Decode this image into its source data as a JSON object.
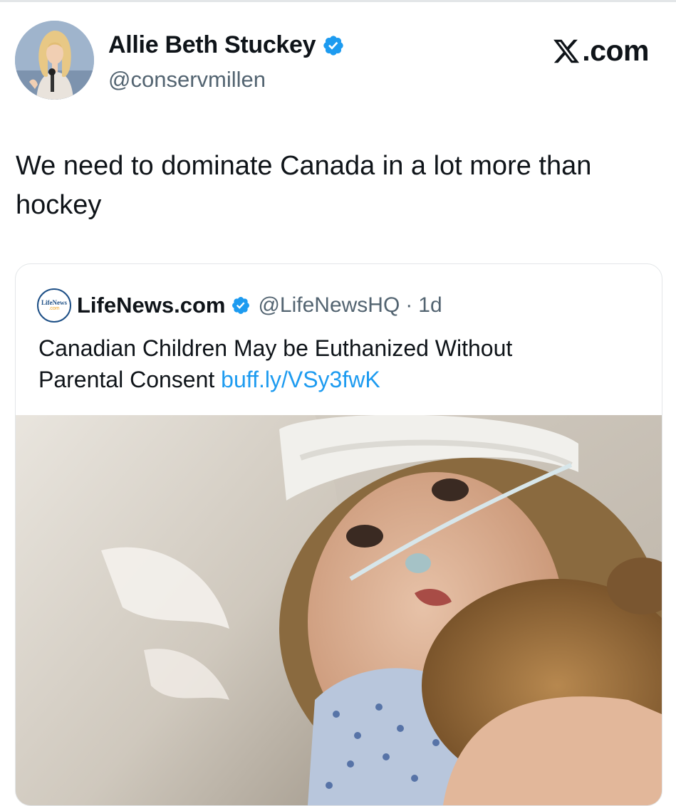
{
  "author": {
    "display_name": "Allie Beth Stuckey",
    "handle": "@conservmillen",
    "verified_icon": "verified-badge-icon",
    "avatar_icon": "avatar-photo"
  },
  "site_badge": {
    "label": ".com",
    "icon": "x-logo-icon"
  },
  "tweet": {
    "text_line1": "We need to dominate Canada in a lot more than",
    "text_line2": "hockey"
  },
  "quoted_tweet": {
    "logo_text_top": "LifeNews",
    "logo_text_bottom": ".com",
    "name": "LifeNews.com",
    "handle": "@LifeNewsHQ",
    "separator": "·",
    "time": "1d",
    "text_line1": "Canadian Children May be Euthanized Without",
    "text_line2_prefix": "Parental Consent ",
    "link": "buff.ly/VSy3fwK",
    "image_icon": "hospital-child-photo"
  },
  "colors": {
    "text": "#0f1419",
    "secondary": "#536471",
    "link": "#1d9bf0",
    "verified": "#1d9bf0",
    "border": "#e3e6e8"
  }
}
